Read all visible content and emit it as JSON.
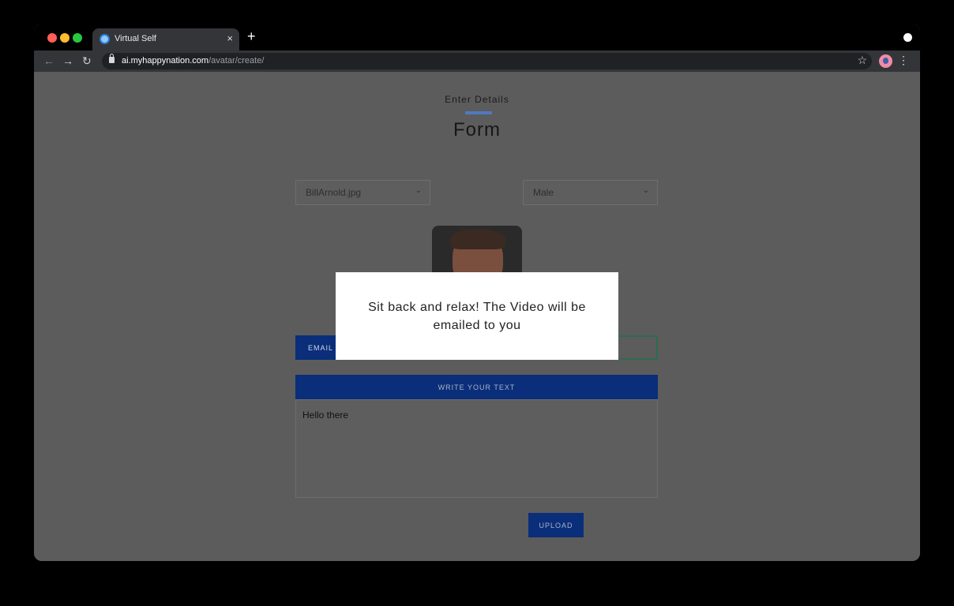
{
  "browser": {
    "tab_title": "Virtual Self",
    "close_glyph": "×",
    "new_tab_glyph": "+",
    "url_host": "ai.myhappynation.com",
    "url_path": "/avatar/create/",
    "back_glyph": "←",
    "forward_glyph": "→",
    "reload_glyph": "↻",
    "star_glyph": "☆",
    "menu_glyph": "⋮",
    "traffic_lights": [
      "#ff5f57",
      "#febc2e",
      "#28c840"
    ]
  },
  "page": {
    "eyebrow": "Enter Details",
    "title": "Form",
    "image_select": "BillArnold.jpg",
    "gender_select": "Male",
    "chevron_glyph": "⌄",
    "email_label": "EMAIL",
    "text_header": "WRITE YOUR TEXT",
    "text_value": "Hello there",
    "upload_label": "UPLOAD",
    "accent_color": "#0a2e7a"
  },
  "modal": {
    "message": "Sit back and relax! The Video will be emailed to you"
  }
}
